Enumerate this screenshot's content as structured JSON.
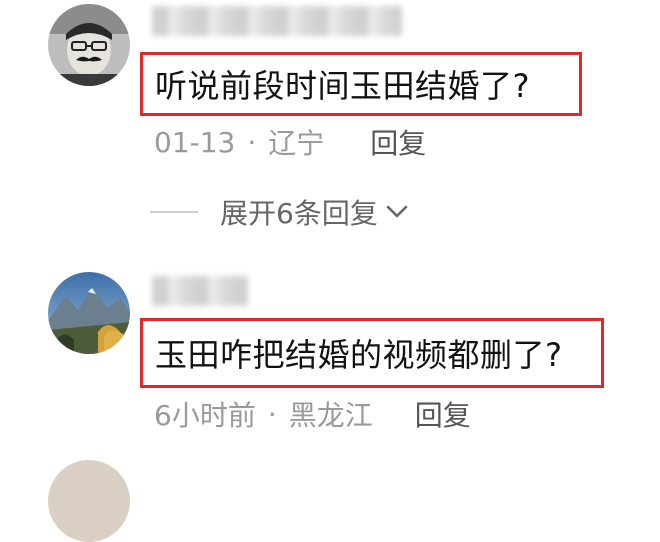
{
  "comments": [
    {
      "text": "听说前段时间玉田结婚了?",
      "date": "01-13",
      "separator": "·",
      "location": "辽宁",
      "reply_label": "回复",
      "expand_label": "展开6条回复"
    },
    {
      "text": "玉田咋把结婚的视频都删了?",
      "date": "6小时前",
      "separator": "·",
      "location": "黑龙江",
      "reply_label": "回复"
    }
  ],
  "colors": {
    "highlight_border": "#e02a2a",
    "meta_text": "#9a9a9a"
  },
  "icons": {
    "expand": "chevron-down-icon"
  }
}
